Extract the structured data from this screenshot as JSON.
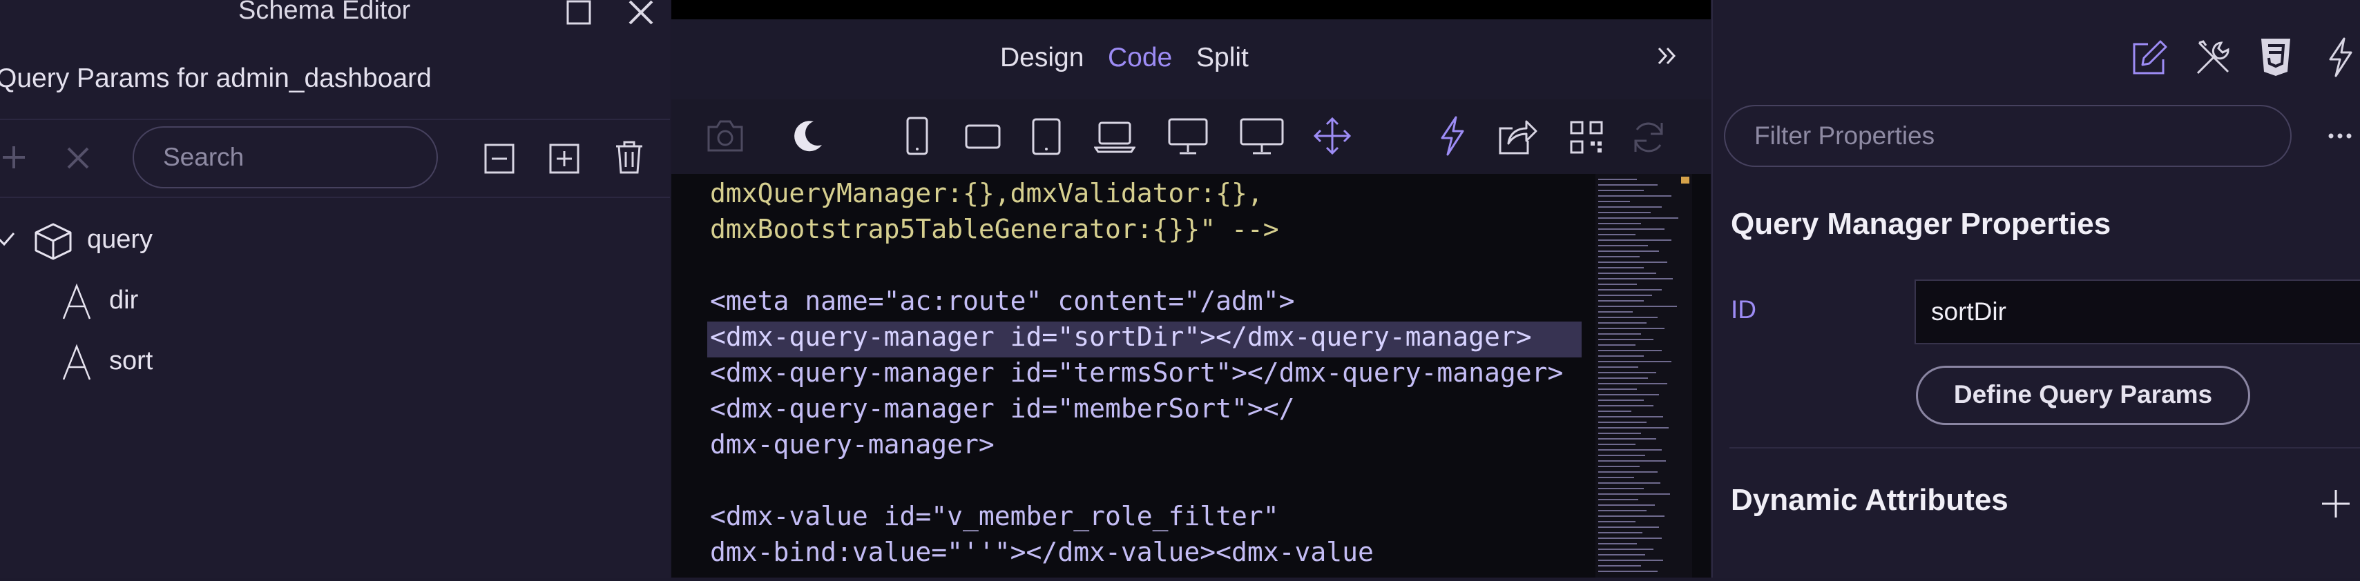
{
  "left_panel": {
    "window_title": "Schema Editor",
    "subtitle": "Query Params for admin_dashboard",
    "search_placeholder": "Search",
    "tree": [
      {
        "label": "query",
        "icon": "cube-icon",
        "checked": true
      },
      {
        "label": "dir",
        "icon": "text-type-icon"
      },
      {
        "label": "sort",
        "icon": "text-type-icon"
      }
    ]
  },
  "center": {
    "view_tabs": [
      "Design",
      "Code",
      "Split"
    ],
    "active_tab": "Code",
    "code_lines": [
      "dmxQueryManager:{},dmxValidator:{},",
      "dmxBootstrap5TableGenerator:{}}\" -->",
      "",
      "<meta name=\"ac:route\" content=\"/adm\">",
      "<dmx-query-manager id=\"sortDir\"></dmx-query-manager>",
      "<dmx-query-manager id=\"termsSort\"></dmx-query-manager>",
      "<dmx-query-manager id=\"memberSort\"></",
      "dmx-query-manager>",
      "",
      "<dmx-value id=\"v_member_role_filter\"",
      "dmx-bind:value=\"''\"></dmx-value><dmx-value"
    ]
  },
  "right_panel": {
    "filter_placeholder": "Filter Properties",
    "section_title": "Query Manager Properties",
    "id_label": "ID",
    "id_value": "sortDir",
    "define_button": "Define Query Params",
    "dynamic_title": "Dynamic Attributes"
  },
  "colors": {
    "accent": "#9d8cf5",
    "panel_bg": "#1e1b2e",
    "editor_bg": "#0b0b10",
    "highlight_line": "#373352"
  }
}
